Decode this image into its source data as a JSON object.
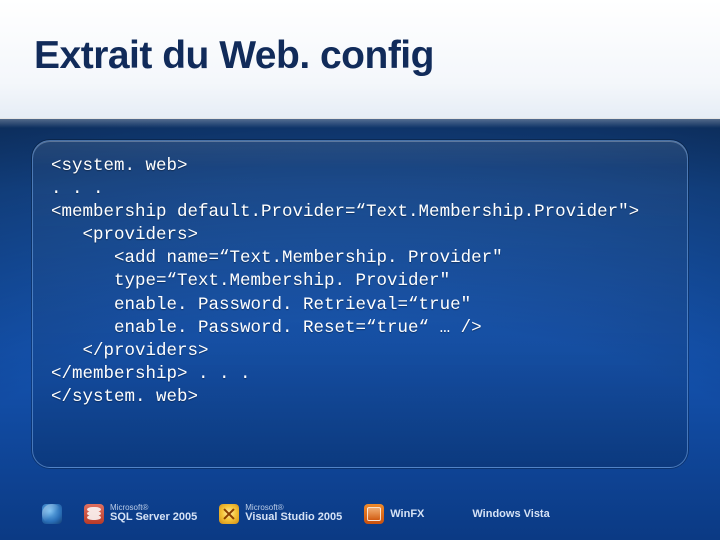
{
  "title": "Extrait du Web. config",
  "code_lines": [
    "<system. web>",
    ". . .",
    "<membership default.Provider=“Text.Membership.Provider\">",
    "   <providers>",
    "      <add name=“Text.Membership. Provider\"",
    "      type=“Text.Membership. Provider\"",
    "      enable. Password. Retrieval=“true\"",
    "      enable. Password. Reset=“true“ … />",
    "   </providers>",
    "</membership> . . .",
    "</system. web>"
  ],
  "footer": {
    "hp": "",
    "sql_small": "Microsoft®",
    "sql_main": "SQL Server 2005",
    "vs_small": "Microsoft®",
    "vs_main": "Visual Studio 2005",
    "winfx": "WinFX",
    "vista": "Windows Vista"
  }
}
